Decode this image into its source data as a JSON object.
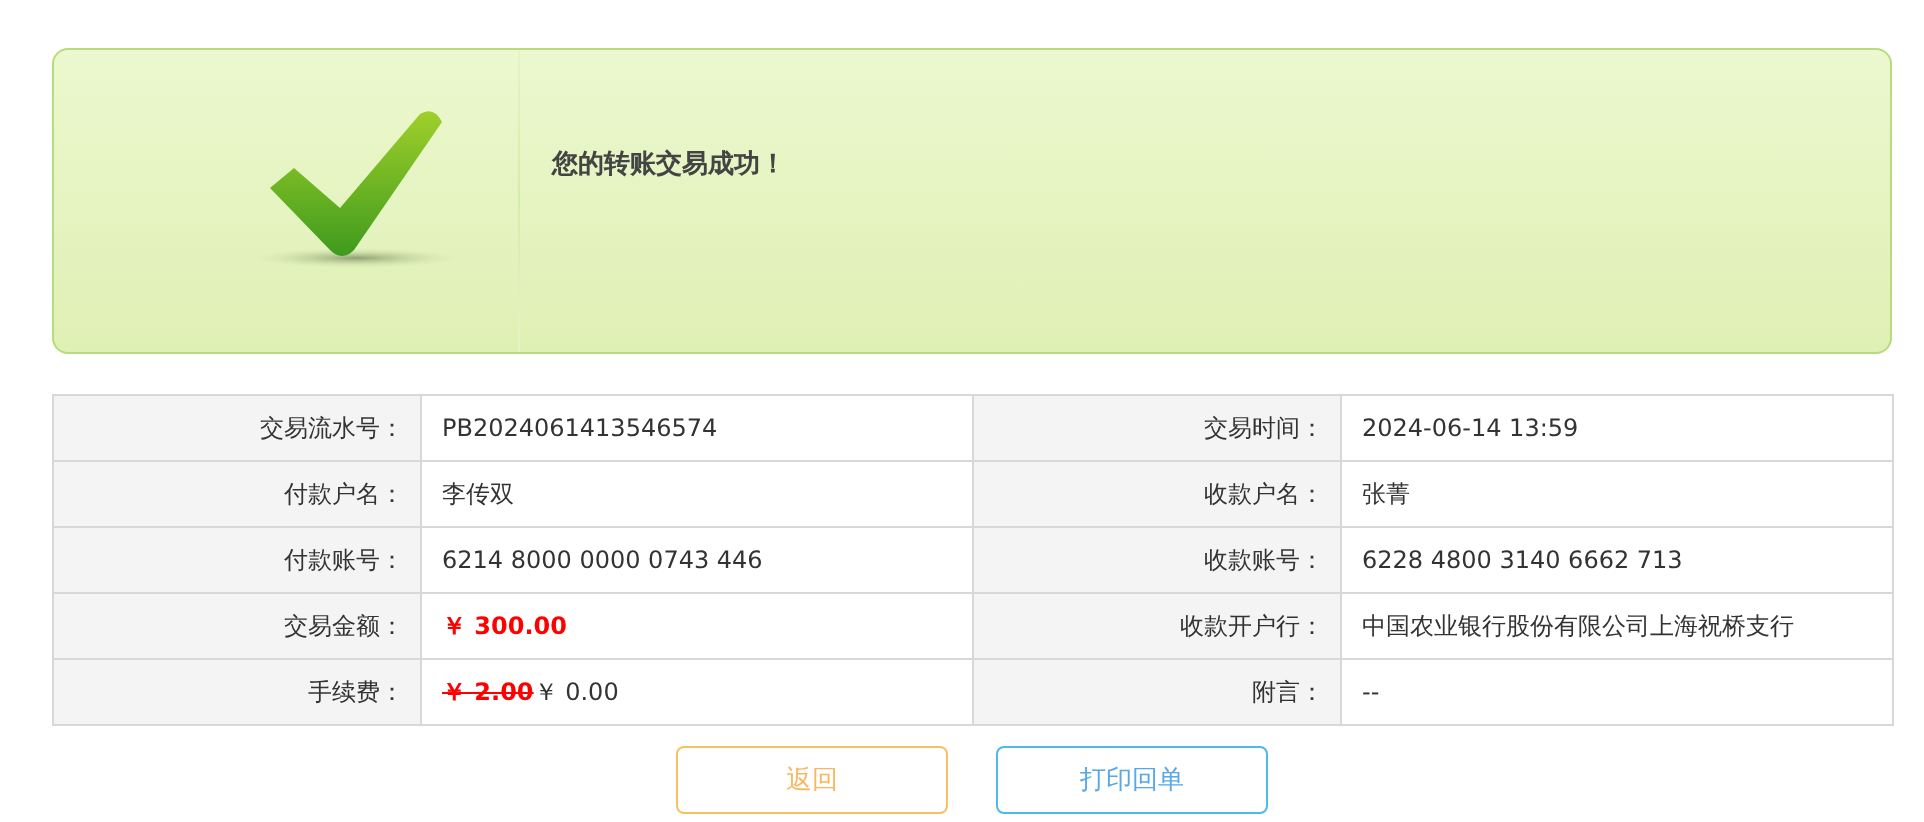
{
  "banner": {
    "message": "您的转账交易成功！"
  },
  "rows": [
    {
      "cells": [
        {
          "label": "交易流水号：",
          "kind": "text",
          "value": "PB2024061413546574"
        },
        {
          "label": "交易时间：",
          "kind": "text",
          "value": "2024-06-14 13:59"
        }
      ]
    },
    {
      "cells": [
        {
          "label": "付款户名：",
          "kind": "text",
          "value": "李传双"
        },
        {
          "label": "收款户名：",
          "kind": "text",
          "value": "张菁"
        }
      ]
    },
    {
      "cells": [
        {
          "label": "付款账号：",
          "kind": "text",
          "value": "6214 8000 0000 0743 446"
        },
        {
          "label": "收款账号：",
          "kind": "text",
          "value": "6228 4800 3140 6662 713"
        }
      ]
    },
    {
      "cells": [
        {
          "label": "交易金额：",
          "kind": "amount",
          "value": "￥ 300.00"
        },
        {
          "label": "收款开户行：",
          "kind": "text",
          "value": "中国农业银行股份有限公司上海祝桥支行"
        }
      ]
    },
    {
      "cells": [
        {
          "label": "手续费：",
          "kind": "fee",
          "original": "￥ 2.00",
          "value": "￥ 0.00"
        },
        {
          "label": "附言：",
          "kind": "text",
          "value": "--"
        }
      ]
    }
  ],
  "buttons": [
    {
      "label": "返回",
      "kind": "back"
    },
    {
      "label": "打印回单",
      "kind": "print"
    }
  ]
}
